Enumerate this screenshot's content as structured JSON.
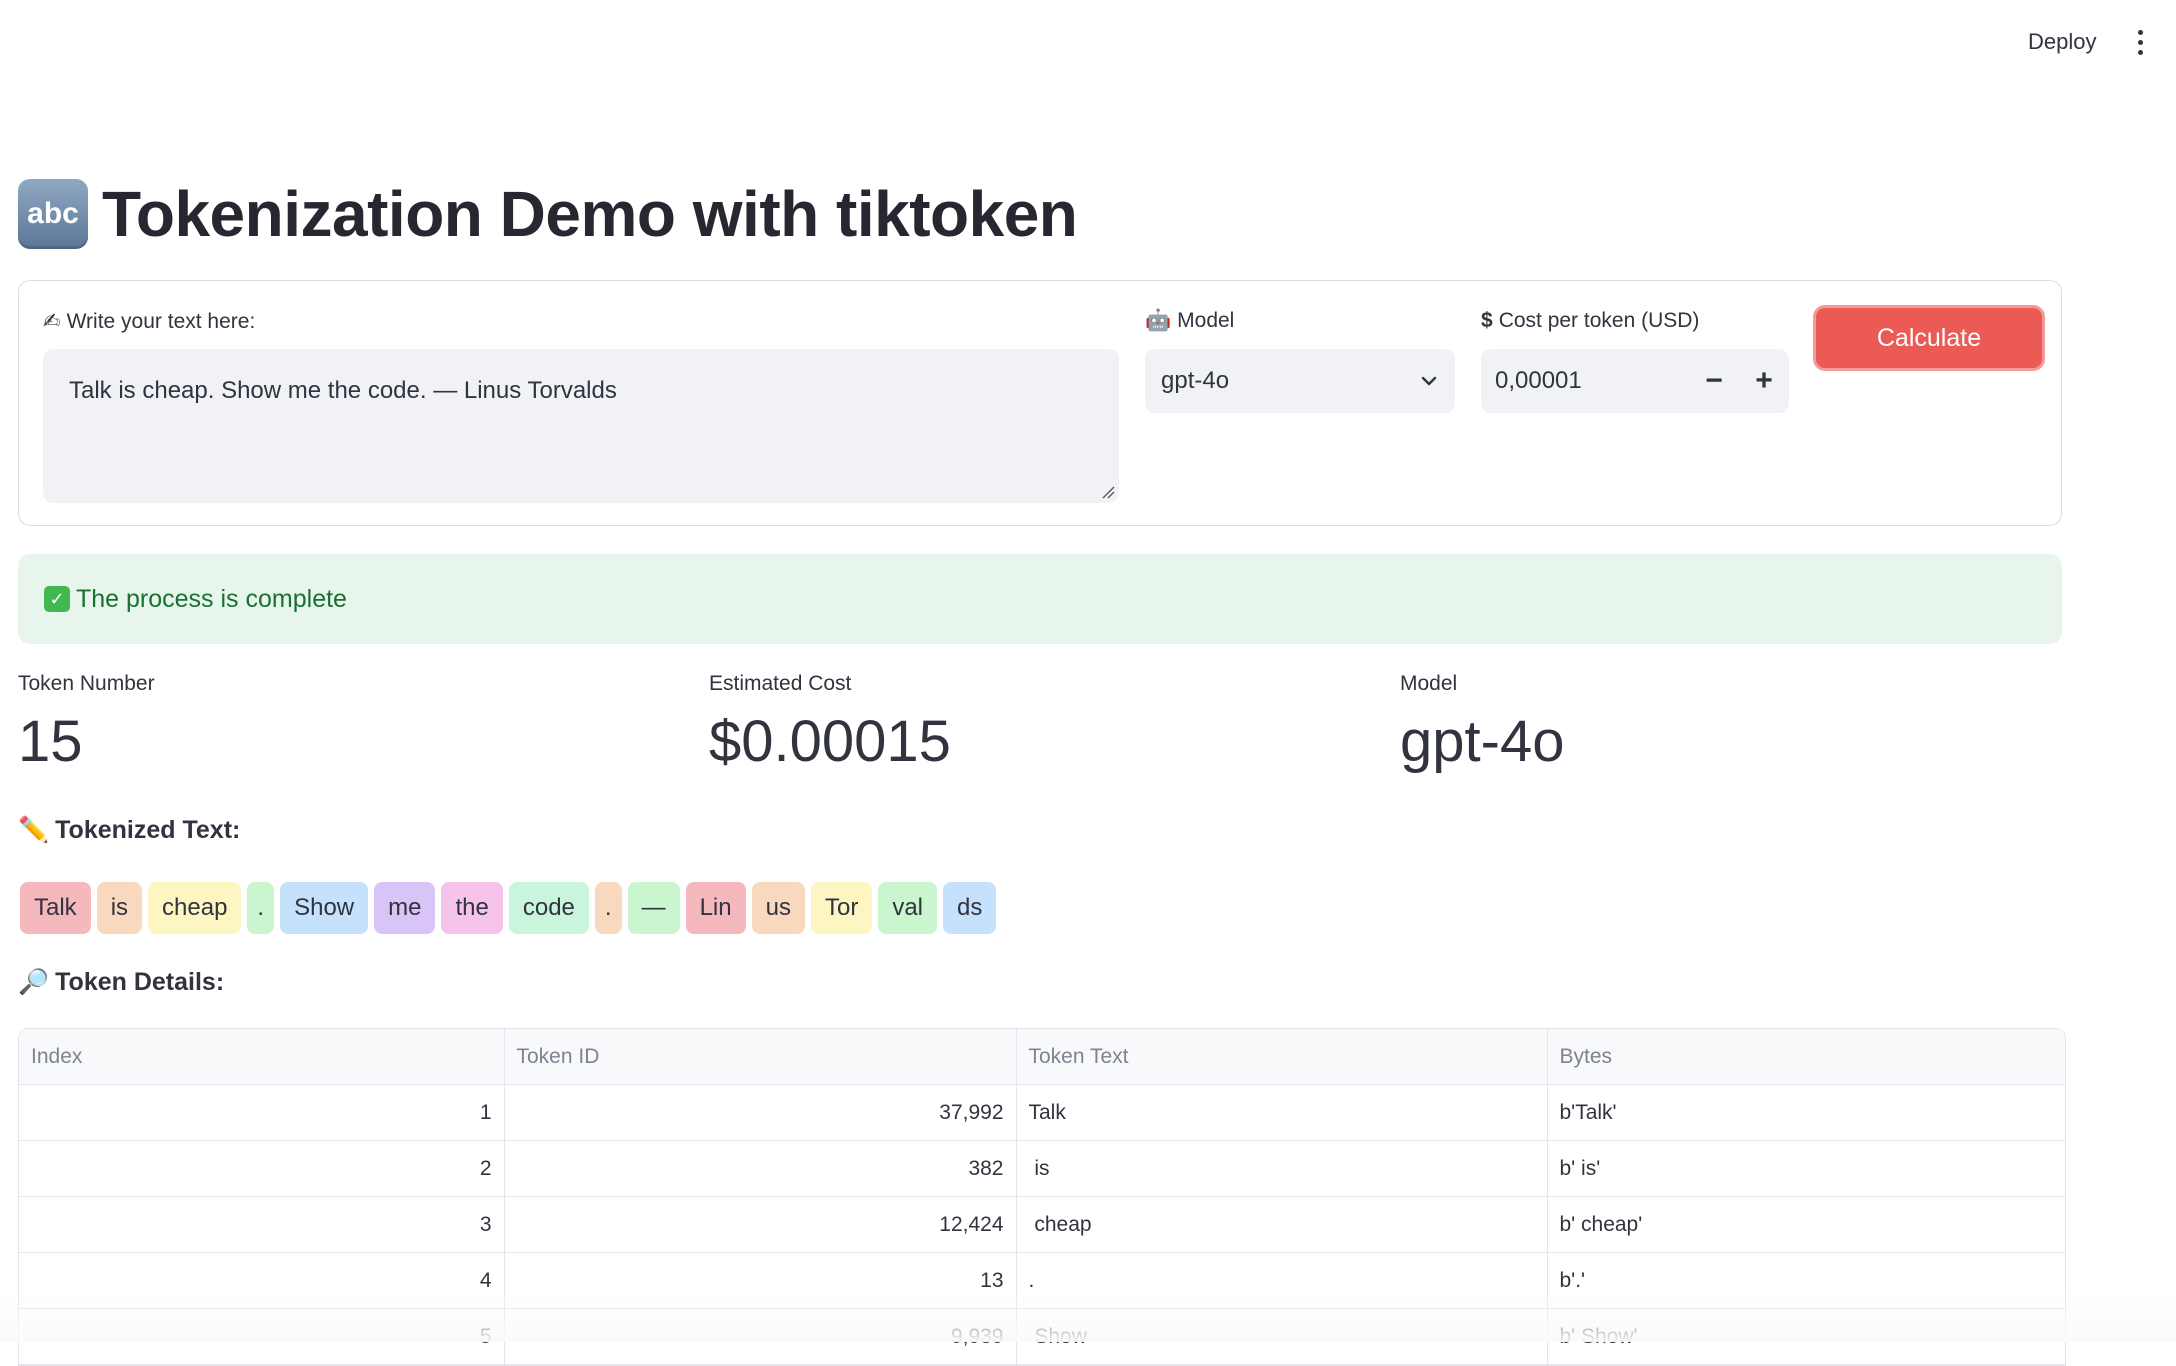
{
  "header": {
    "deploy_label": "Deploy"
  },
  "title": {
    "icon_text": "abc",
    "text": "Tokenization Demo with tiktoken"
  },
  "form": {
    "text_label": "Write your text here:",
    "text_value": "Talk is cheap. Show me the code. — Linus Torvalds",
    "model_label": "Model",
    "model_value": "gpt-4o",
    "cost_label": "Cost per token (USD)",
    "cost_value": "0,00001",
    "calculate_label": "Calculate"
  },
  "status": {
    "message": "The process is complete"
  },
  "metrics": [
    {
      "label": "Token Number",
      "value": "15"
    },
    {
      "label": "Estimated Cost",
      "value": "$0.00015"
    },
    {
      "label": "Model",
      "value": "gpt-4o"
    }
  ],
  "tokenized": {
    "heading": "Tokenized Text:",
    "tokens": [
      {
        "text": "Talk",
        "color": "#f5b8bd"
      },
      {
        "text": "is",
        "color": "#f8d9bd"
      },
      {
        "text": "cheap",
        "color": "#fdf6c3"
      },
      {
        "text": ".",
        "color": "#c9f5cf"
      },
      {
        "text": "Show",
        "color": "#c5e1fb"
      },
      {
        "text": "me",
        "color": "#d9c4f7"
      },
      {
        "text": "the",
        "color": "#f6c4ea"
      },
      {
        "text": "code",
        "color": "#c8f5dc"
      },
      {
        "text": ".",
        "color": "#f8d9bd"
      },
      {
        "text": "—",
        "color": "#c9f5cf"
      },
      {
        "text": "Lin",
        "color": "#f5b8bd"
      },
      {
        "text": "us",
        "color": "#f8d9bd"
      },
      {
        "text": "Tor",
        "color": "#fdf6c3"
      },
      {
        "text": "val",
        "color": "#c9f5cf"
      },
      {
        "text": "ds",
        "color": "#c5e1fb"
      }
    ]
  },
  "details": {
    "heading": "Token Details:",
    "columns": [
      "Index",
      "Token ID",
      "Token Text",
      "Bytes"
    ],
    "rows": [
      [
        "1",
        "37,992",
        "Talk",
        "b'Talk'"
      ],
      [
        "2",
        "382",
        " is",
        "b' is'"
      ],
      [
        "3",
        "12,424",
        " cheap",
        "b' cheap'"
      ],
      [
        "4",
        "13",
        ".",
        "b'.'"
      ],
      [
        "5",
        "9,939",
        " Show",
        "b' Show'"
      ]
    ]
  }
}
